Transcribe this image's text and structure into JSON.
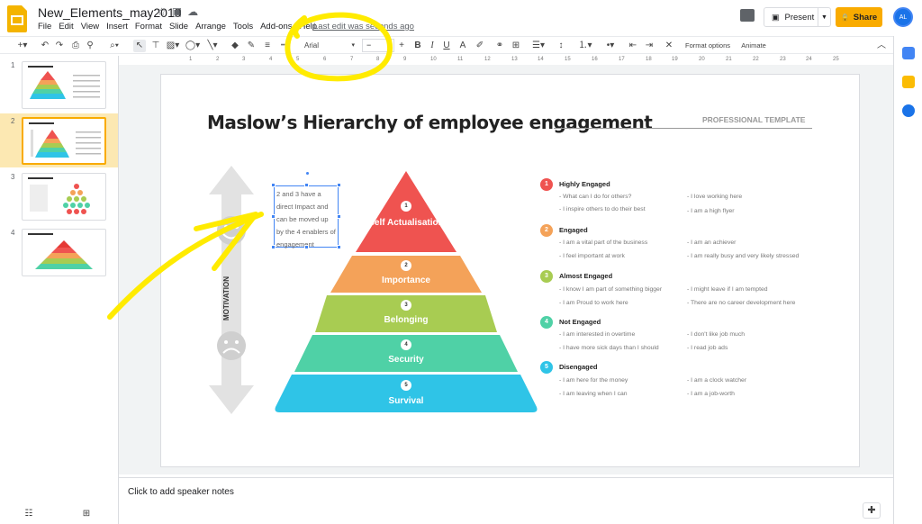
{
  "header": {
    "doc_title": "New_Elements_may2019",
    "menu": [
      "File",
      "Edit",
      "View",
      "Insert",
      "Format",
      "Slide",
      "Arrange",
      "Tools",
      "Add-ons",
      "Help"
    ],
    "last_edit": "Last edit was seconds ago",
    "present_label": "Present",
    "share_label": "Share",
    "avatar_initials": "AL"
  },
  "toolbar": {
    "font": "Arial",
    "size_minus": "−",
    "size_plus": "+",
    "format_options": "Format options",
    "animate": "Animate"
  },
  "ruler": [
    "1",
    "2",
    "3",
    "4",
    "5",
    "6",
    "7",
    "8",
    "9",
    "10",
    "11",
    "12",
    "13",
    "14",
    "15",
    "16",
    "17",
    "18",
    "19",
    "20",
    "21",
    "22",
    "23",
    "24",
    "25"
  ],
  "filmstrip": {
    "slides": [
      {
        "num": "1",
        "active": false
      },
      {
        "num": "2",
        "active": true
      },
      {
        "num": "3",
        "active": false
      },
      {
        "num": "4",
        "active": false
      }
    ]
  },
  "notes": {
    "placeholder": "Click to add speaker notes"
  },
  "slide": {
    "title": "Maslow’s Hierarchy of employee engagement",
    "tag": "PROFESSIONAL TEMPLATE",
    "textbox": "2 and 3 have a direct Impact and can be moved up by the 4 enablers of engagement",
    "motivation": "MOTIVATION",
    "pyramid": [
      {
        "num": "1",
        "label": "Self Actualisation",
        "color": "#ef5350"
      },
      {
        "num": "2",
        "label": "Importance",
        "color": "#f4a259"
      },
      {
        "num": "3",
        "label": "Belonging",
        "color": "#a8cc52"
      },
      {
        "num": "4",
        "label": "Security",
        "color": "#4fd1a6"
      },
      {
        "num": "5",
        "label": "Survival",
        "color": "#2fc4e7"
      }
    ],
    "levels": [
      {
        "num": "1",
        "title": "Highly Engaged",
        "color": "#ef5350",
        "items": [
          "- What can I do for others?",
          "- I love working here",
          "- I inspire others to do their best",
          "- I am a high flyer"
        ]
      },
      {
        "num": "2",
        "title": "Engaged",
        "color": "#f4a259",
        "items": [
          "- I am a vital part of the business",
          "- I am an achiever",
          "- I feel important at work",
          "- I am really busy and very likely stressed"
        ]
      },
      {
        "num": "3",
        "title": "Almost Engaged",
        "color": "#a8cc52",
        "items": [
          "- I know I am part of something bigger",
          "- I might leave if I am tempted",
          "- I am Proud to work here",
          "- There are no career development here"
        ]
      },
      {
        "num": "4",
        "title": "Not Engaged",
        "color": "#4fd1a6",
        "items": [
          "- I am interested in overtime",
          "- I don't like job much",
          "- I have more sick days than I should",
          "- I read job ads"
        ]
      },
      {
        "num": "5",
        "title": "Disengaged",
        "color": "#2fc4e7",
        "items": [
          "- I am here for the money",
          "- I am a clock watcher",
          "- I am leaving when I can",
          "- I am a job-worth"
        ]
      }
    ]
  }
}
